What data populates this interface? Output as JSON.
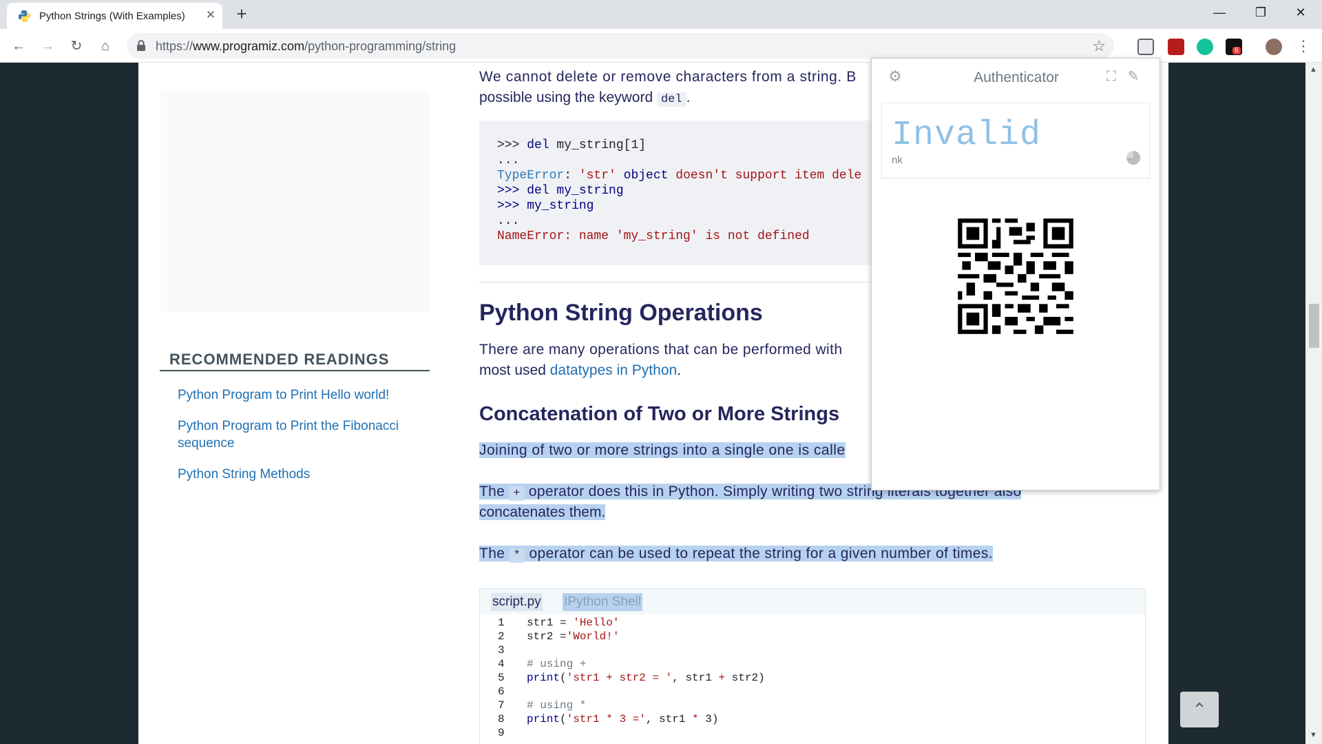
{
  "browser": {
    "tab_title": "Python Strings (With Examples)",
    "new_tab_symbol": "+",
    "close_symbol": "✕",
    "url_scheme": "https://",
    "url_host": "www.programiz.com",
    "url_path": "/python-programming/string",
    "window_controls": {
      "minimize": "—",
      "maximize": "❐",
      "close": "✕"
    },
    "extension_badge": "6"
  },
  "sidebar": {
    "heading": "RECOMMENDED READINGS",
    "links": [
      "Python Program to Print Hello world!",
      "Python Program to Print the Fibonacci sequence",
      "Python String Methods"
    ]
  },
  "article": {
    "p_delete_1": "We cannot delete or remove characters from a string. B",
    "p_delete_2a": "possible using the keyword ",
    "p_delete_kw": "del",
    "p_delete_2b": ".",
    "code_block": {
      "l1_prompt": ">>> ",
      "l1_kw": "del",
      "l1_rest": " my_string[1]",
      "l2": "...",
      "l3_err": "TypeError",
      "l3_colon": ": ",
      "l3_str": "'str'",
      "l3_kw": " object",
      "l3_rest": " doesn't support item dele",
      "l4": ">>> del my_string",
      "l5": ">>> my_string",
      "l6": "...",
      "l7_err": "NameError",
      "l7_rest": ": name 'my_string' is not defined"
    },
    "h2_operations": "Python String Operations",
    "p_ops_1": "There are many operations that can be performed with",
    "p_ops_2a": "most used ",
    "p_ops_link": "datatypes in Python",
    "p_ops_2b": ".",
    "h3_concat": "Concatenation of Two or More Strings",
    "p_join": "Joining of two or more strings into a single one is calle",
    "p_plus_1a": "The ",
    "p_plus_sym": "+",
    "p_plus_1b": " operator does this in Python. Simply writing two string literals together also",
    "p_plus_2": "concatenates them.",
    "p_star_a": "The ",
    "p_star_sym": "*",
    "p_star_b": " operator can be used to repeat the string for a given number of times."
  },
  "ide": {
    "tabs": [
      "script.py",
      "IPython Shell"
    ],
    "lines": [
      "1",
      "2",
      "3",
      "4",
      "5",
      "6",
      "7",
      "8",
      "9"
    ],
    "code": {
      "l1a": "str1 = ",
      "l1b": "'Hello'",
      "l2a": "str2 =",
      "l2b": "'World!'",
      "l4": "# using +",
      "l5a": "print",
      "l5b": "(",
      "l5c": "'str1 + str2 = '",
      "l5d": ", str1 ",
      "l5e": "+",
      "l5f": " str2)",
      "l7": "# using *",
      "l8a": "print",
      "l8b": "(",
      "l8c": "'str1 * 3 ='",
      "l8d": ", str1 ",
      "l8e": "*",
      "l8f": " 3)"
    }
  },
  "authenticator": {
    "title": "Authenticator",
    "code": "Invalid",
    "account": "nk"
  },
  "scroll_to_top": "⌃",
  "colors": {
    "accent": "#1f6fb3",
    "selection": "#b7d2f0",
    "heading": "#25265e"
  }
}
